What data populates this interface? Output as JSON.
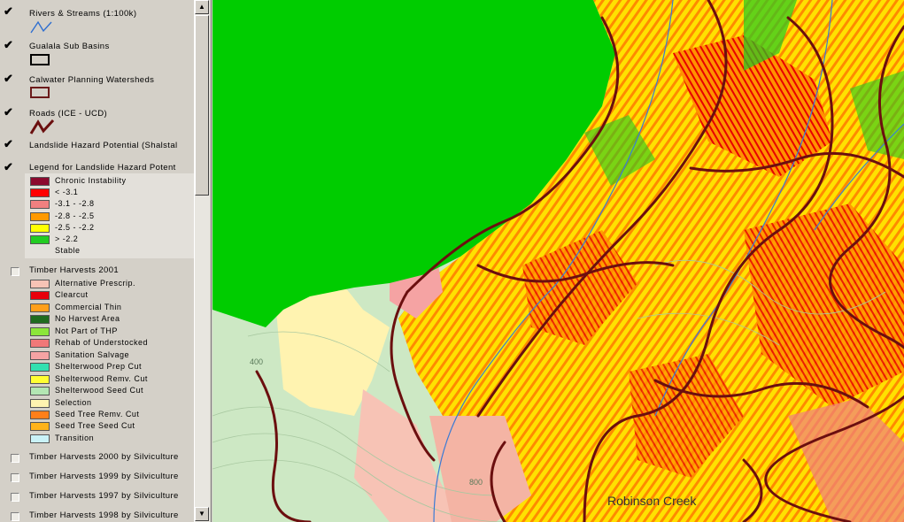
{
  "toc": {
    "layers_top": [
      {
        "name": "Rivers & Streams (1:100k)"
      },
      {
        "name": "Gualala Sub Basins"
      },
      {
        "name": "Calwater Planning Watersheds"
      },
      {
        "name": "Roads (ICE - UCD)"
      },
      {
        "name": "Landslide Hazard Potential (Shalstal"
      },
      {
        "name": "Legend for Landslide Hazard Potent"
      }
    ],
    "landslide_legend": [
      {
        "label": "Chronic Instability",
        "color": "#8b0a2e"
      },
      {
        "label": "<  -3.1",
        "color": "#ff0000"
      },
      {
        "label": "-3.1 - -2.8",
        "color": "#f08080"
      },
      {
        "label": "-2.8 - -2.5",
        "color": "#ff9900"
      },
      {
        "label": "-2.5 - -2.2",
        "color": "#ffff00"
      },
      {
        "label": ">  -2.2",
        "color": "#22cc22"
      },
      {
        "label": "Stable",
        "color": ""
      }
    ],
    "timber_2001": {
      "name": "Timber Harvests 2001"
    },
    "timber_legend": [
      {
        "label": "Alternative Prescrip.",
        "color": "#f7c3b5"
      },
      {
        "label": "Clearcut",
        "color": "#e8000b"
      },
      {
        "label": "Commercial Thin",
        "color": "#ff9f1a"
      },
      {
        "label": "No Harvest Area",
        "color": "#1f6b1f"
      },
      {
        "label": "Not Part of THP",
        "color": "#8ce63a"
      },
      {
        "label": "Rehab of Understocked",
        "color": "#f07878"
      },
      {
        "label": "Sanitation Salvage",
        "color": "#f5a3a3"
      },
      {
        "label": "Shelterwood Prep Cut",
        "color": "#33e0b0"
      },
      {
        "label": "Shelterwood Remv. Cut",
        "color": "#ffff33"
      },
      {
        "label": "Shelterwood Seed Cut",
        "color": "#b3e6b3"
      },
      {
        "label": "Selection",
        "color": "#fff3b0"
      },
      {
        "label": "Seed Tree Remv. Cut",
        "color": "#ff7f1a"
      },
      {
        "label": "Seed Tree Seed Cut",
        "color": "#ffb31a"
      },
      {
        "label": "Transition",
        "color": "#c9f2f7"
      }
    ],
    "layers_bottom": [
      {
        "name": "Timber Harvests 2000 by Silviculture"
      },
      {
        "name": "Timber Harvests 1999 by Silviculture"
      },
      {
        "name": "Timber Harvests 1997 by Silviculture"
      },
      {
        "name": "Timber Harvests 1998 by Silviculture"
      }
    ]
  },
  "map": {
    "place_label": "Robinson Creek",
    "contour_labels": [
      "400",
      "800"
    ],
    "colors": {
      "lake": "#00cc00",
      "road": "#6b0f0f",
      "background": "#c8e6c0"
    }
  },
  "scroll": {
    "up": "▲",
    "down": "▼"
  }
}
